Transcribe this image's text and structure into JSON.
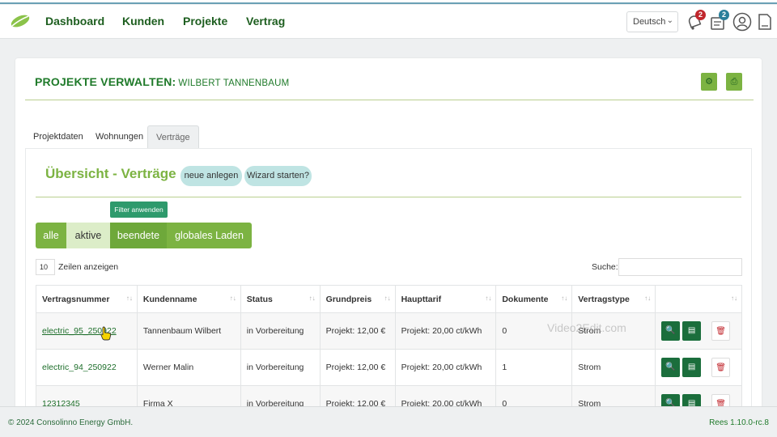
{
  "navbar": {
    "links": [
      "Dashboard",
      "Kunden",
      "Projekte",
      "Vertrag"
    ],
    "language": "Deutsch",
    "notifications_badge": "2",
    "tasks_badge": "2",
    "icons": [
      "leaf-logo-icon",
      "bell-icon",
      "clipboard-icon",
      "user-icon",
      "document-icon"
    ]
  },
  "header": {
    "title": "PROJEKTE VERWALTEN:",
    "subtitle": "WILBERT TANNENBAUM",
    "icons": [
      "gear-icon",
      "print-icon"
    ]
  },
  "tabs": [
    "Projektdaten",
    "Wohnungen",
    "Verträge"
  ],
  "active_tab": "Verträge",
  "section": {
    "title": "Übersicht - Verträge",
    "new_label": "neue anlegen",
    "wizard_label": "Wizard starten?",
    "filter_label": "Filter anwenden"
  },
  "segments": [
    "alle",
    "aktive",
    "beendete",
    "globales Laden"
  ],
  "active_segment": "aktive",
  "table_controls": {
    "length_value": "10",
    "length_label": "Zeilen anzeigen",
    "search_label": "Suche:",
    "search_value": ""
  },
  "table": {
    "columns": [
      "Vertragsnummer",
      "Kundenname",
      "Status",
      "Grundpreis",
      "Haupttarif",
      "Dokumente",
      "Vertragstype",
      ""
    ],
    "rows": [
      [
        "electric_95_250922",
        "Tannenbaum Wilbert",
        "in Vorbereitung",
        "Projekt: 12,00 €",
        "Projekt: 20,00 ct/kWh",
        "0",
        "Strom"
      ],
      [
        "electric_94_250922",
        "Werner Malin",
        "in Vorbereitung",
        "Projekt: 12,00 €",
        "Projekt: 20,00 ct/kWh",
        "1",
        "Strom"
      ],
      [
        "12312345",
        "Firma X",
        "in Vorbereitung",
        "Projekt: 12,00 €",
        "Projekt: 20,00 ct/kWh",
        "0",
        "Strom"
      ]
    ],
    "row_action_icons": [
      "search-icon",
      "pdf-icon",
      "trash-icon"
    ]
  },
  "watermark": "Video2Edit.com",
  "footer": {
    "copyright": "© 2024 Consolinno Energy GmbH.",
    "version": "Rees 1.10.0-rc.8"
  },
  "colors": {
    "brand_green": "#7cb342",
    "dark_green": "#1d5e1f",
    "action_green": "#1b6e3c",
    "pill_teal": "#bfe4e3",
    "badge_red": "#c1272d"
  }
}
